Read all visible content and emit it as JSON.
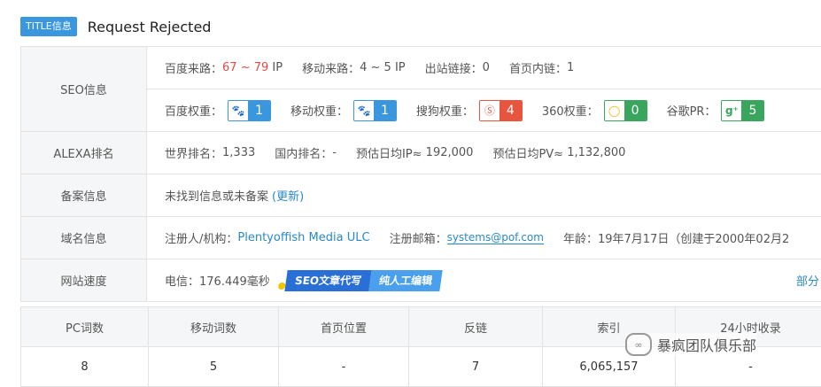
{
  "title": {
    "tag": "TITLE信息",
    "text": "Request Rejected"
  },
  "seo": {
    "label": "SEO信息",
    "row1": [
      {
        "key": "百度来路：",
        "value": "67 ~ 79",
        "unit": "IP"
      },
      {
        "key": "移动来路：",
        "value": "4 ~ 5",
        "unit": "IP"
      },
      {
        "key": "出站链接：",
        "value": "0"
      },
      {
        "key": "首页内链：",
        "value": "1"
      }
    ],
    "row2": [
      {
        "key": "百度权重：",
        "value": "1",
        "icon": "baidu-paw-icon"
      },
      {
        "key": "移动权重：",
        "value": "1",
        "icon": "baidu-paw-icon"
      },
      {
        "key": "搜狗权重：",
        "value": "4",
        "icon": "sogou-icon"
      },
      {
        "key": "360权重：",
        "value": "0",
        "icon": "360-icon"
      },
      {
        "key": "谷歌PR：",
        "value": "5",
        "icon": "google-plus-icon"
      }
    ]
  },
  "alexa": {
    "label": "ALEXA排名",
    "items": [
      {
        "key": "世界排名：",
        "value": "1,333"
      },
      {
        "key": "国内排名：",
        "value": "-"
      },
      {
        "key": "预估日均IP≈",
        "value": "192,000"
      },
      {
        "key": "预估日均PV≈",
        "value": "1,132,800"
      }
    ]
  },
  "beian": {
    "label": "备案信息",
    "text": "未找到信息或未备案",
    "link": "(更新)"
  },
  "domain": {
    "label": "域名信息",
    "registrant_key": "注册人/机构：",
    "registrant_value": "Plentyoffish Media ULC",
    "email_key": "注册邮箱：",
    "email_value": "systems@pof.com",
    "age_key": "年龄：",
    "age_value": "19年7月17日（创建于2000年02月2"
  },
  "speed": {
    "label": "网站速度",
    "text": "电信：176.449毫秒",
    "promo1": "SEO文章代写",
    "promo2": "纯人工编辑",
    "more": "部分"
  },
  "stats": {
    "headers": [
      "PC词数",
      "移动词数",
      "首页位置",
      "反链",
      "索引",
      "24小时收录"
    ],
    "values": [
      "8",
      "5",
      "-",
      "7",
      "6,065,157",
      "-"
    ]
  },
  "watermark": {
    "text": "暴疯团队俱乐部"
  },
  "colors": {
    "accent_blue": "#3a96dd",
    "red": "#e24a4a",
    "sogou_red": "#e8553e",
    "green": "#3aa55d"
  }
}
